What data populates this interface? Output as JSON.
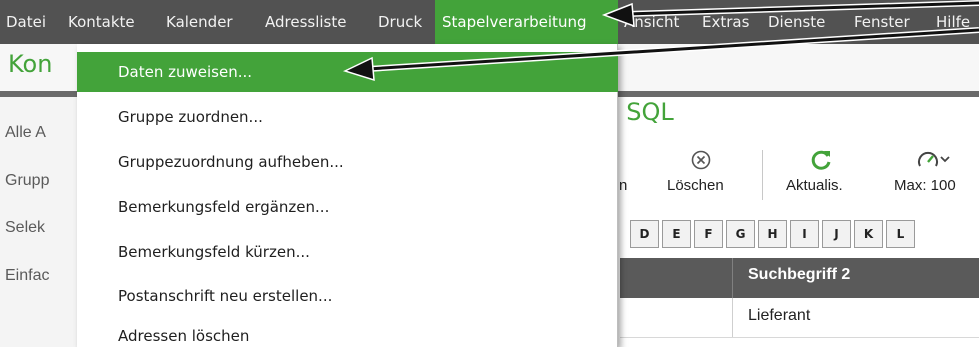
{
  "menubar": {
    "items": [
      {
        "label": "Datei"
      },
      {
        "label": "Kontakte"
      },
      {
        "label": "Kalender"
      },
      {
        "label": "Adressliste"
      },
      {
        "label": "Druck"
      },
      {
        "label": "Stapelverarbeitung",
        "active": true
      },
      {
        "label": "Ansicht"
      },
      {
        "label": "Extras"
      },
      {
        "label": "Dienste"
      },
      {
        "label": "Fenster"
      },
      {
        "label": "Hilfe"
      }
    ]
  },
  "background_app": {
    "title": "Kon",
    "main_title": "- SQL",
    "sidebar": [
      "Alle A",
      "Grupp",
      "Selek",
      "Einfac"
    ],
    "toolbar": {
      "partial_label": "n",
      "delete_label": "Löschen",
      "refresh_label": "Aktualis.",
      "max_label": "Max: 100"
    },
    "letters": [
      "D",
      "E",
      "F",
      "G",
      "H",
      "I",
      "J",
      "K",
      "L"
    ],
    "table": {
      "column_header": "Suchbegriff 2",
      "rows": [
        {
          "suchbegriff2": "Lieferant"
        }
      ]
    }
  },
  "dropdown": {
    "items": [
      {
        "label": "Daten zuweisen...",
        "highlighted": true
      },
      {
        "label": "Gruppe zuordnen..."
      },
      {
        "label": "Gruppezuordnung aufheben..."
      },
      {
        "label": "Bemerkungsfeld ergänzen..."
      },
      {
        "label": "Bemerkungsfeld kürzen..."
      },
      {
        "label": "Postanschrift neu erstellen..."
      },
      {
        "label": "Adressen löschen"
      }
    ]
  },
  "colors": {
    "menubar": "#525252",
    "accent_green": "#43a33a",
    "arrow": "#111111"
  }
}
